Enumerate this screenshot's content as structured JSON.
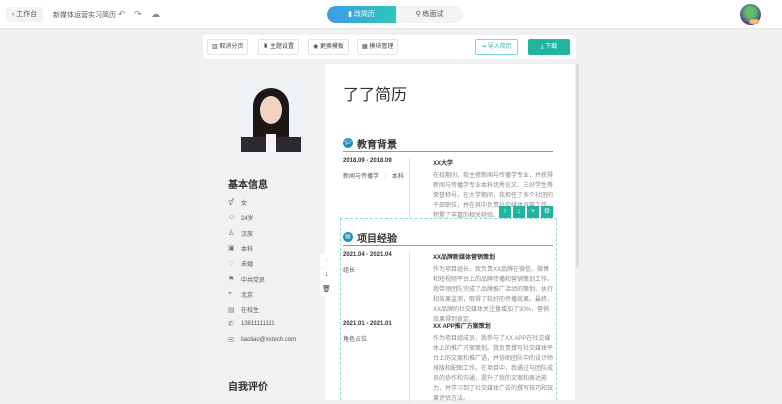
{
  "topbar": {
    "back_label": "工作台",
    "doc_title": "新媒体运营实习简历",
    "tab_edit": "改简历",
    "tab_interview": "练面试",
    "vip_badge": "VIP"
  },
  "toolbar": {
    "items": [
      "取消分页",
      "主题设置",
      "更换模板",
      "模块管理"
    ],
    "import_label": "导入简历",
    "download_label": "下载"
  },
  "profile": {
    "basic_info_title": "基本信息",
    "items": [
      {
        "icon": "gender-icon",
        "glyph": "⚥",
        "text": "女"
      },
      {
        "icon": "user-icon",
        "glyph": "☺",
        "text": "24岁"
      },
      {
        "icon": "ethnicity-icon",
        "glyph": "♙",
        "text": "汉族"
      },
      {
        "icon": "education-icon",
        "glyph": "▣",
        "text": "本科"
      },
      {
        "icon": "marital-icon",
        "glyph": "♡",
        "text": "未婚"
      },
      {
        "icon": "party-icon",
        "glyph": "⚑",
        "text": "中共党员"
      },
      {
        "icon": "location-icon",
        "glyph": "⌖",
        "text": "北京"
      },
      {
        "icon": "status-icon",
        "glyph": "▤",
        "text": "在校生"
      },
      {
        "icon": "phone-icon",
        "glyph": "✆",
        "text": "13811111111"
      },
      {
        "icon": "mail-icon",
        "glyph": "✉",
        "text": "liaoliao@xxtech.com"
      }
    ],
    "self_eval_title": "自我评价"
  },
  "resume": {
    "name": "了了简历",
    "education": {
      "title": "教育背景",
      "date": "2018.09 - 2018.09",
      "major": "新闻与传播学",
      "degree": "本科",
      "school": "XX大学",
      "desc": "在校期间，我主修新闻与传播学专业，并获得新闻与传播学专业本科优秀论文、三好学生等荣誉称号。在大学期间，我担任了多个社团的干部职位，并在其中负责社交媒体运营工作，积累了丰富的相关经验。"
    },
    "projects": {
      "title": "项目经验",
      "items": [
        {
          "date": "2021.04 - 2021.04",
          "role": "组长",
          "name": "XX品牌新媒体营销策划",
          "desc": "作为项目组长，我负责XX品牌在微信、微博和短视频平台上的品牌传播和营销策划工作。我带领团队完成了品牌推广活动的策划、执行和效果监测，取得了较好的传播效果。最终，XX品牌的社交媒体关注量增加了30%，营销效果得到肯定。"
        },
        {
          "date": "2021.01 - 2021.01",
          "role": "角色占位",
          "name": "XX APP推广方案策划",
          "desc": "作为项目组成员，我参与了XX APP在社交媒体上的推广方案策划。我负责撰写社交媒体平台上的文案和推广语，并协助团队中的设计师排版和配图工作。在项目中，我通过与团队成员的协作和沟通，提升了我的文案和表达能力，并学习到了社交媒体广告的撰写技巧和效果评估方法。"
        }
      ]
    }
  },
  "colors": {
    "accent": "#1fb59f",
    "section_icon": "#1a8fb0"
  }
}
